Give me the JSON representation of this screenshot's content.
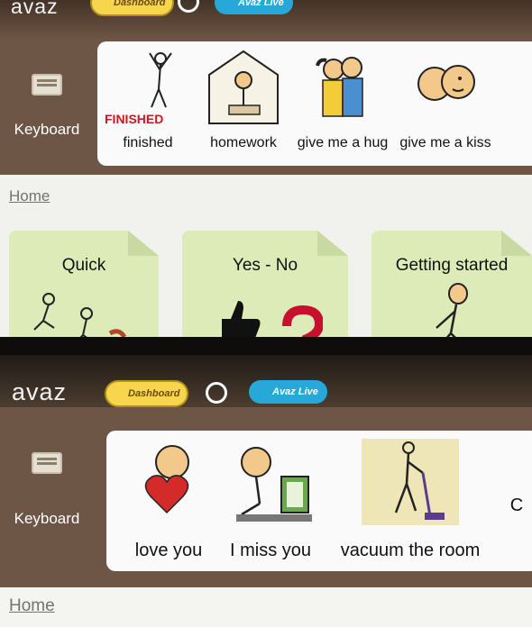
{
  "top_panel": {
    "app_logo": "avaz",
    "dashboard_pill": "Dashboard",
    "live_pill": "Avaz Live",
    "keyboard_label": "Keyboard",
    "sentence": [
      {
        "label": "finished",
        "pic_text": "FINISHED"
      },
      {
        "label": "homework"
      },
      {
        "label": "give me a hug"
      },
      {
        "label": "give me a kiss"
      }
    ],
    "breadcrumb": "Home",
    "folders": [
      {
        "title": "Quick"
      },
      {
        "title": "Yes - No"
      },
      {
        "title": "Getting started"
      }
    ]
  },
  "bottom_panel": {
    "app_logo": "avaz",
    "dashboard_pill": "Dashboard",
    "live_pill": "Avaz Live",
    "keyboard_label": "Keyboard",
    "sentence": [
      {
        "label": "love you"
      },
      {
        "label": "I miss you"
      },
      {
        "label": "vacuum the room"
      },
      {
        "label": "C"
      }
    ],
    "breadcrumb": "Home"
  },
  "colors": {
    "toolbar_brown": "#6e5646",
    "folder_green": "#dcebb8",
    "dashboard_yellow": "#f7d64d",
    "live_blue": "#26a8d8",
    "finished_red": "#c41b22"
  }
}
